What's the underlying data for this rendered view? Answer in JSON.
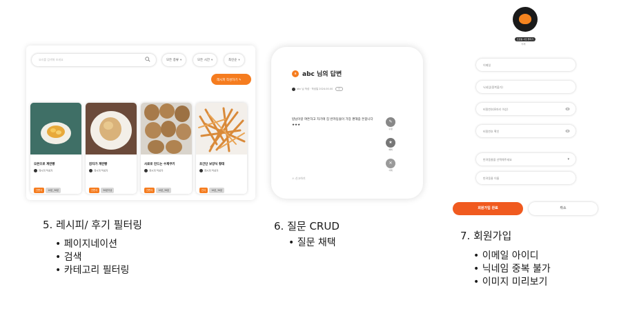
{
  "recipe_panel": {
    "search_placeholder": "요리를 검색해 보세요",
    "filters": [
      "모든 종류",
      "모든 시간",
      "최신순"
    ],
    "write_button": "레시피 작성하기",
    "cards": [
      {
        "title": "오븐으로 계란빵",
        "author": "레시피 작성자",
        "tags": [
          "간편식",
          "10분_30분"
        ]
      },
      {
        "title": "감자가 계란빵",
        "author": "레시피 작성자",
        "tags": [
          "간편식",
          "30분이상"
        ]
      },
      {
        "title": "사료로 만드는 수제쿠키",
        "author": "레시피 작성자",
        "tags": [
          "간편식",
          "10분_30분"
        ]
      },
      {
        "title": "초간단 보양식 황태",
        "author": "레시피 작성자",
        "tags": [
          "간식",
          "10분_30분"
        ]
      }
    ]
  },
  "question_panel": {
    "avatar_letter": "a",
    "title": "abc 님의 답변",
    "meta": "abc 님 작성 · 작성일 2024.00.00",
    "meta_chip": "0",
    "body": "밥님이랑 여튼하고 자기에 집 반려동물이 가장 편해줌 돈합니다 ★★★",
    "actions": [
      "수정",
      "채택",
      "삭제"
    ],
    "report": "신고하기"
  },
  "signup_panel": {
    "profile_button": "프로필 사진 올리기",
    "profile_delete": "삭제",
    "fields": [
      "이메일",
      "닉네임(중복불가)",
      "비밀번호(8자리 이상)",
      "비밀번호 확인",
      "반려동물을 선택해주세요",
      "반려동물 이름"
    ],
    "submit": "회원가입 완료",
    "cancel": "취소"
  },
  "captions": {
    "recipe": {
      "heading": "5. 레시피/ 후기 필터링",
      "items": [
        "페이지네이션",
        "검색",
        "카테고리 필터링"
      ]
    },
    "question": {
      "heading": "6. 질문 CRUD",
      "items": [
        "질문 채택"
      ]
    },
    "signup": {
      "heading": "7. 회원가입",
      "items": [
        "이메일 아이디",
        "닉네임 중복 불가",
        "이미지 미리보기"
      ]
    }
  },
  "colors": {
    "accent": "#f57c1f",
    "submit": "#f05a1f"
  }
}
